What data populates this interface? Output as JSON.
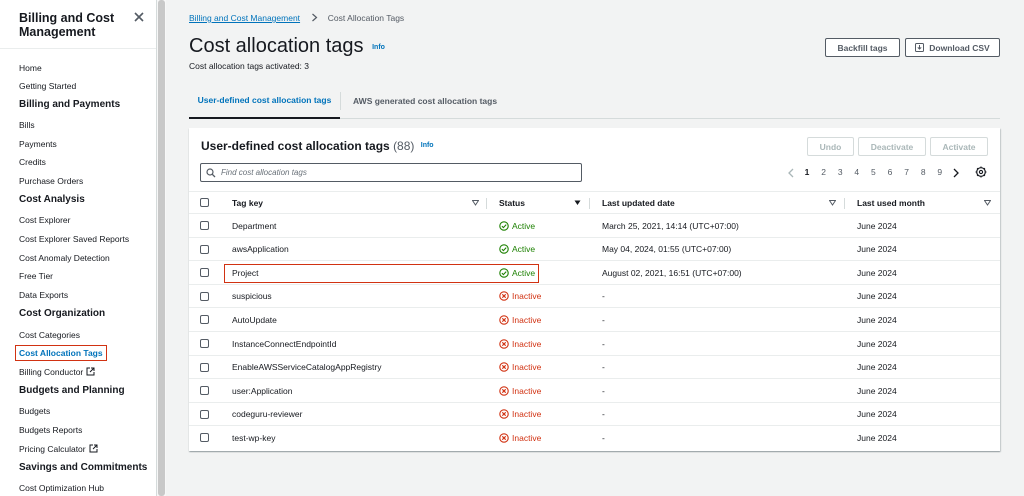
{
  "sidebar": {
    "title": "Billing and Cost Management",
    "items": [
      {
        "label": "Home",
        "type": "item"
      },
      {
        "label": "Getting Started",
        "type": "item"
      },
      {
        "label": "Billing and Payments",
        "type": "heading"
      },
      {
        "label": "Bills",
        "type": "item"
      },
      {
        "label": "Payments",
        "type": "item"
      },
      {
        "label": "Credits",
        "type": "item"
      },
      {
        "label": "Purchase Orders",
        "type": "item"
      },
      {
        "label": "Cost Analysis",
        "type": "heading"
      },
      {
        "label": "Cost Explorer",
        "type": "item"
      },
      {
        "label": "Cost Explorer Saved Reports",
        "type": "item"
      },
      {
        "label": "Cost Anomaly Detection",
        "type": "item"
      },
      {
        "label": "Free Tier",
        "type": "item"
      },
      {
        "label": "Data Exports",
        "type": "item"
      },
      {
        "label": "Cost Organization",
        "type": "heading"
      },
      {
        "label": "Cost Categories",
        "type": "item"
      },
      {
        "label": "Cost Allocation Tags",
        "type": "item",
        "active": true
      },
      {
        "label": "Billing Conductor",
        "type": "item",
        "external": true
      },
      {
        "label": "Budgets and Planning",
        "type": "heading"
      },
      {
        "label": "Budgets",
        "type": "item"
      },
      {
        "label": "Budgets Reports",
        "type": "item"
      },
      {
        "label": "Pricing Calculator",
        "type": "item",
        "external": true
      },
      {
        "label": "Savings and Commitments",
        "type": "heading"
      },
      {
        "label": "Cost Optimization Hub",
        "type": "item"
      }
    ]
  },
  "breadcrumb": {
    "parent": "Billing and Cost Management",
    "current": "Cost Allocation Tags"
  },
  "header": {
    "title": "Cost allocation tags",
    "info": "Info",
    "activated": "Cost allocation tags activated: 3",
    "backfill_label": "Backfill tags",
    "download_label": "Download CSV"
  },
  "tabs": [
    {
      "label": "User-defined cost allocation tags",
      "selected": true
    },
    {
      "label": "AWS generated cost allocation tags",
      "selected": false
    }
  ],
  "table": {
    "title": "User-defined cost allocation tags",
    "count": "(88)",
    "info": "Info",
    "undo_label": "Undo",
    "deactivate_label": "Deactivate",
    "activate_label": "Activate",
    "search_placeholder": "Find cost allocation tags",
    "pages": [
      "1",
      "2",
      "3",
      "4",
      "5",
      "6",
      "7",
      "8",
      "9"
    ],
    "current_page": "1",
    "columns": [
      "Tag key",
      "Status",
      "Last updated date",
      "Last used month"
    ],
    "rows": [
      {
        "key": "Department",
        "status": "Active",
        "updated": "March 25, 2021, 14:14 (UTC+07:00)",
        "used": "June 2024"
      },
      {
        "key": "awsApplication",
        "status": "Active",
        "updated": "May 04, 2024, 01:55 (UTC+07:00)",
        "used": "June 2024"
      },
      {
        "key": "Project",
        "status": "Active",
        "updated": "August 02, 2021, 16:51 (UTC+07:00)",
        "used": "June 2024"
      },
      {
        "key": "suspicious",
        "status": "Inactive",
        "updated": "-",
        "used": "June 2024"
      },
      {
        "key": "AutoUpdate",
        "status": "Inactive",
        "updated": "-",
        "used": "June 2024"
      },
      {
        "key": "InstanceConnectEndpointId",
        "status": "Inactive",
        "updated": "-",
        "used": "June 2024"
      },
      {
        "key": "EnableAWSServiceCatalogAppRegistry",
        "status": "Inactive",
        "updated": "-",
        "used": "June 2024"
      },
      {
        "key": "user:Application",
        "status": "Inactive",
        "updated": "-",
        "used": "June 2024"
      },
      {
        "key": "codeguru-reviewer",
        "status": "Inactive",
        "updated": "-",
        "used": "June 2024"
      },
      {
        "key": "test-wp-key",
        "status": "Inactive",
        "updated": "-",
        "used": "June 2024"
      }
    ]
  },
  "icons": {
    "close": "close-icon",
    "external": "external-link-icon",
    "breadcrumb_sep": "chevron-right-icon",
    "download": "download-icon",
    "search": "search-icon",
    "prev": "chevron-left-icon",
    "next": "chevron-right-icon",
    "settings": "gear-icon",
    "active": "check-circle-icon",
    "inactive": "x-circle-icon"
  },
  "colors": {
    "link": "#0073bb",
    "active": "#1d8102",
    "inactive": "#d13212",
    "highlight": "#d13212"
  }
}
